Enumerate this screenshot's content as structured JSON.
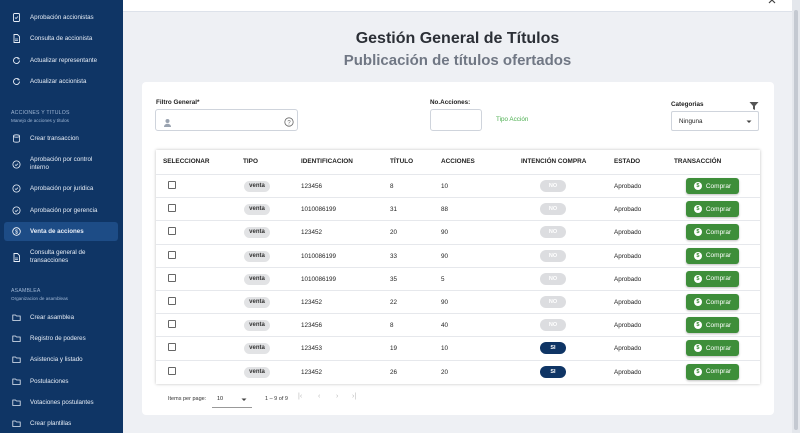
{
  "sidebar": {
    "items_top": [
      {
        "label": "Aprobación accionistas",
        "icon": "check-doc-icon"
      },
      {
        "label": "Consulta de accionista",
        "icon": "doc-icon"
      },
      {
        "label": "Actualizar representante",
        "icon": "refresh-icon"
      },
      {
        "label": "Actualizar accionista",
        "icon": "refresh-icon"
      }
    ],
    "section1": {
      "title": "ACCIONES Y TITULOS",
      "subtitle": "Manejo de acciones y títulos"
    },
    "items_mid": [
      {
        "label": "Crear transaccion",
        "icon": "database-icon"
      },
      {
        "label": "Aprobación por control interno",
        "icon": "check-circle-icon"
      },
      {
        "label": "Aprobación por juridica",
        "icon": "check-circle-icon"
      },
      {
        "label": "Aprobación por gerencia",
        "icon": "check-circle-icon"
      },
      {
        "label": "Venta de acciones",
        "icon": "dollar-icon",
        "active": true
      },
      {
        "label": "Consulta general de transacciones",
        "icon": "doc-icon"
      }
    ],
    "section2": {
      "title": "ASAMBLEA",
      "subtitle": "Organizacion de asambleas"
    },
    "items_bottom": [
      {
        "label": "Crear asamblea",
        "icon": "folder-icon"
      },
      {
        "label": "Registro de poderes",
        "icon": "folder-icon"
      },
      {
        "label": "Asistencia y listado",
        "icon": "folder-icon"
      },
      {
        "label": "Postulaciones",
        "icon": "folder-icon"
      },
      {
        "label": "Votaciones postulantes",
        "icon": "folder-icon"
      },
      {
        "label": "Crear plantillas",
        "icon": "folder-icon"
      }
    ]
  },
  "header": {
    "title": "Gestión General de Títulos",
    "subtitle": "Publicación de títulos ofertados"
  },
  "filters": {
    "filtro_label": "Filtro General*",
    "acciones_label": "No.Acciones:",
    "tipo_accion": "Tipo Acción",
    "categorias_label": "Categorias",
    "categorias_value": "Ninguna"
  },
  "table": {
    "headers": [
      "SELECCIONAR",
      "TIPO",
      "IDENTIFICACION",
      "TÍTULO",
      "ACCIONES",
      "INTENCIÓN COMPRA",
      "ESTADO",
      "TRANSACCIÓN"
    ],
    "rows": [
      {
        "tipo": "venta",
        "id": "123456",
        "titulo": "8",
        "acciones": "10",
        "intencion": "NO",
        "estado": "Aprobado",
        "btn": "Comprar"
      },
      {
        "tipo": "venta",
        "id": "1010086199",
        "titulo": "31",
        "acciones": "88",
        "intencion": "NO",
        "estado": "Aprobado",
        "btn": "Comprar"
      },
      {
        "tipo": "venta",
        "id": "123452",
        "titulo": "20",
        "acciones": "90",
        "intencion": "NO",
        "estado": "Aprobado",
        "btn": "Comprar"
      },
      {
        "tipo": "venta",
        "id": "1010086199",
        "titulo": "33",
        "acciones": "90",
        "intencion": "NO",
        "estado": "Aprobado",
        "btn": "Comprar"
      },
      {
        "tipo": "venta",
        "id": "1010086199",
        "titulo": "35",
        "acciones": "5",
        "intencion": "NO",
        "estado": "Aprobado",
        "btn": "Comprar"
      },
      {
        "tipo": "venta",
        "id": "123452",
        "titulo": "22",
        "acciones": "90",
        "intencion": "NO",
        "estado": "Aprobado",
        "btn": "Comprar"
      },
      {
        "tipo": "venta",
        "id": "123456",
        "titulo": "8",
        "acciones": "40",
        "intencion": "NO",
        "estado": "Aprobado",
        "btn": "Comprar"
      },
      {
        "tipo": "venta",
        "id": "123453",
        "titulo": "19",
        "acciones": "10",
        "intencion": "SI",
        "estado": "Aprobado",
        "btn": "Comprar"
      },
      {
        "tipo": "venta",
        "id": "123452",
        "titulo": "26",
        "acciones": "20",
        "intencion": "SI",
        "estado": "Aprobado",
        "btn": "Comprar"
      }
    ]
  },
  "pagination": {
    "items_label": "Items per page:",
    "page_size": "10",
    "range": "1 – 9 of 9"
  },
  "colors": {
    "sidebar": "#0f3565",
    "buy_button": "#3e8e3a",
    "tipo_accion": "#4caf50"
  }
}
